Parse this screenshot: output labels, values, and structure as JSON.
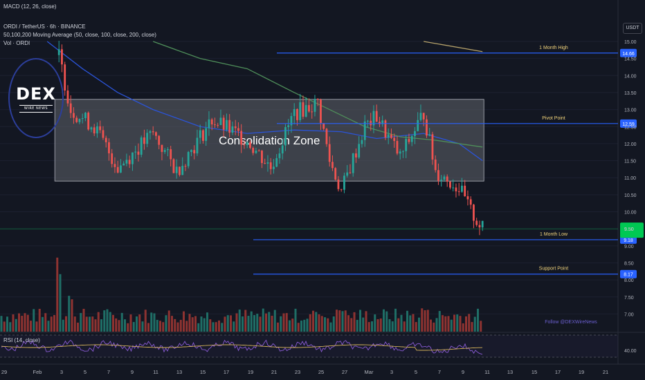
{
  "legend": {
    "macd": "MACD (12, 26, close)",
    "symbol": "ORDI / TetherUS · 6h · BINANCE",
    "ma": "50,100,200 Moving Average (50, close, 100, close, 200, close)",
    "vol": "Vol · ORDI"
  },
  "currency": "USDT",
  "logo": {
    "main": "DEX",
    "sub": "WIRE NEWS"
  },
  "watermark": "Follow @DEXWireNews",
  "rsi": {
    "label": "RSI (14, close)",
    "axis_value": "40.00"
  },
  "current_price_label": "9.50",
  "colors": {
    "background": "#131722",
    "up": "#26a69a",
    "down": "#ef5350",
    "vol_up": "#1f6e66",
    "vol_down": "#8e3331",
    "level": "#2962ff",
    "zone_fill": "#5a5d66",
    "ma50": "#2b54d9",
    "ma100": "#4f8f5a",
    "ma200": "#b7a36b",
    "rsi": "#8b5cd6",
    "rsi_ma": "#d6b45a",
    "current_price": "#00c853"
  },
  "chart_data": {
    "type": "candlestick",
    "price_axis": {
      "min": 9.0,
      "max": 15.0,
      "ticks": [
        "15.00",
        "14.50",
        "14.00",
        "13.50",
        "13.00",
        "12.50",
        "12.00",
        "11.50",
        "11.00",
        "10.50",
        "10.00",
        "9.50",
        "9.00",
        "8.50",
        "8.00",
        "7.50",
        "7.00"
      ]
    },
    "x_axis": {
      "ticks": [
        "29",
        "Feb",
        "3",
        "5",
        "7",
        "9",
        "11",
        "13",
        "15",
        "17",
        "19",
        "21",
        "23",
        "25",
        "27",
        "Mar",
        "3",
        "5",
        "7",
        "9",
        "11",
        "13",
        "15",
        "17",
        "19",
        "21"
      ]
    },
    "zone": {
      "label": "Consolidation Zone",
      "top": 13.3,
      "bottom": 10.9,
      "x_start": "Feb 1",
      "x_end": "Mar 8"
    },
    "levels": [
      {
        "label": "1 Month High",
        "value": 14.66,
        "value_text": "14.66"
      },
      {
        "label": "Pivot Point",
        "value": 12.59,
        "value_text": "12.59"
      },
      {
        "label": "1 Month Low",
        "value": 9.18,
        "value_text": "9.18"
      },
      {
        "label": "Support Point",
        "value": 8.17,
        "value_text": "8.17"
      }
    ],
    "anchors": [
      {
        "x": "Feb 1",
        "price": 14.6
      },
      {
        "x": "Feb 2",
        "price": 13.0
      },
      {
        "x": "Feb 4",
        "price": 12.5
      },
      {
        "x": "Feb 6",
        "price": 11.3
      },
      {
        "x": "Feb 9",
        "price": 12.3
      },
      {
        "x": "Feb 11",
        "price": 11.2
      },
      {
        "x": "Feb 14",
        "price": 12.7
      },
      {
        "x": "Feb 17",
        "price": 12.1
      },
      {
        "x": "Feb 19",
        "price": 11.3
      },
      {
        "x": "Feb 21",
        "price": 12.9
      },
      {
        "x": "Feb 23",
        "price": 13.2
      },
      {
        "x": "Feb 24",
        "price": 11.5
      },
      {
        "x": "Feb 25",
        "price": 10.6
      },
      {
        "x": "Feb 27",
        "price": 12.5
      },
      {
        "x": "Feb 28",
        "price": 12.8
      },
      {
        "x": "Mar 1",
        "price": 11.6
      },
      {
        "x": "Mar 3",
        "price": 12.9
      },
      {
        "x": "Mar 4",
        "price": 11.2
      },
      {
        "x": "Mar 6",
        "price": 10.7
      },
      {
        "x": "Mar 7",
        "price": 10.0
      },
      {
        "x": "Mar 8",
        "price": 9.5
      }
    ],
    "moving_averages": [
      {
        "name": "MA 50",
        "points": [
          [
            "Jan 31",
            15.0
          ],
          [
            "Feb 3",
            14.2
          ],
          [
            "Feb 6",
            13.5
          ],
          [
            "Feb 9",
            13.0
          ],
          [
            "Feb 13",
            12.5
          ],
          [
            "Feb 17",
            12.3
          ],
          [
            "Feb 21",
            12.4
          ],
          [
            "Feb 25",
            12.35
          ],
          [
            "Feb 28",
            12.15
          ],
          [
            "Mar 3",
            12.3
          ],
          [
            "Mar 6",
            12.0
          ],
          [
            "Mar 8",
            11.5
          ]
        ]
      },
      {
        "name": "MA 100",
        "points": [
          [
            "Feb 9",
            15.0
          ],
          [
            "Feb 13",
            14.5
          ],
          [
            "Feb 17",
            14.2
          ],
          [
            "Feb 21",
            13.5
          ],
          [
            "Feb 24",
            13.0
          ],
          [
            "Feb 27",
            12.5
          ],
          [
            "Mar 1",
            12.2
          ],
          [
            "Mar 4",
            12.1
          ],
          [
            "Mar 8",
            11.9
          ]
        ]
      },
      {
        "name": "MA 200",
        "points": [
          [
            "Mar 3",
            15.0
          ],
          [
            "Mar 8",
            14.7
          ]
        ]
      }
    ],
    "volume_spikes": [
      {
        "x": "Feb 1",
        "relative": 1.0
      },
      {
        "x": "Feb 2",
        "relative": 0.55
      },
      {
        "x": "Feb 23",
        "relative": 0.3
      },
      {
        "x": "Feb 25",
        "relative": 0.35
      },
      {
        "x": "Mar 3",
        "relative": 0.3
      }
    ]
  }
}
